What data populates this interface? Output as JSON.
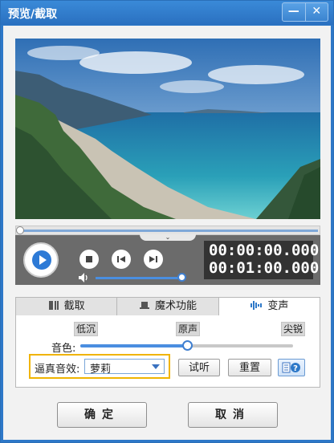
{
  "window": {
    "title": "预览/截取",
    "minimize_glyph": "—",
    "close_glyph": "✕"
  },
  "player": {
    "current_time": "00:00:00.000",
    "total_time": "00:01:00.000",
    "playback_progress": 0.0,
    "volume_level": 0.92,
    "icons": [
      "play-icon",
      "stop-icon",
      "prev-frame-icon",
      "next-frame-icon",
      "volume-icon",
      "collapse-chevron-icon"
    ]
  },
  "tabs": [
    {
      "label": "截取",
      "icon": "crop-icon",
      "active": false
    },
    {
      "label": "魔术功能",
      "icon": "magic-hat-icon",
      "active": false
    },
    {
      "label": "变声",
      "icon": "soundwave-icon",
      "active": true
    }
  ],
  "voice": {
    "tone_label": "音色:",
    "marks": {
      "low": "低沉",
      "mid": "原声",
      "high": "尖锐"
    },
    "tone_level": 0.5,
    "effect_label": "逼真音效:",
    "effect_value": "萝莉",
    "listen_button": "试听",
    "reset_button": "重置",
    "help_icon": "help-icon"
  },
  "footer": {
    "ok_button": "确定",
    "cancel_button": "取消"
  },
  "colors": {
    "accent": "#2d78c8",
    "highlight_border": "#f0b400"
  }
}
